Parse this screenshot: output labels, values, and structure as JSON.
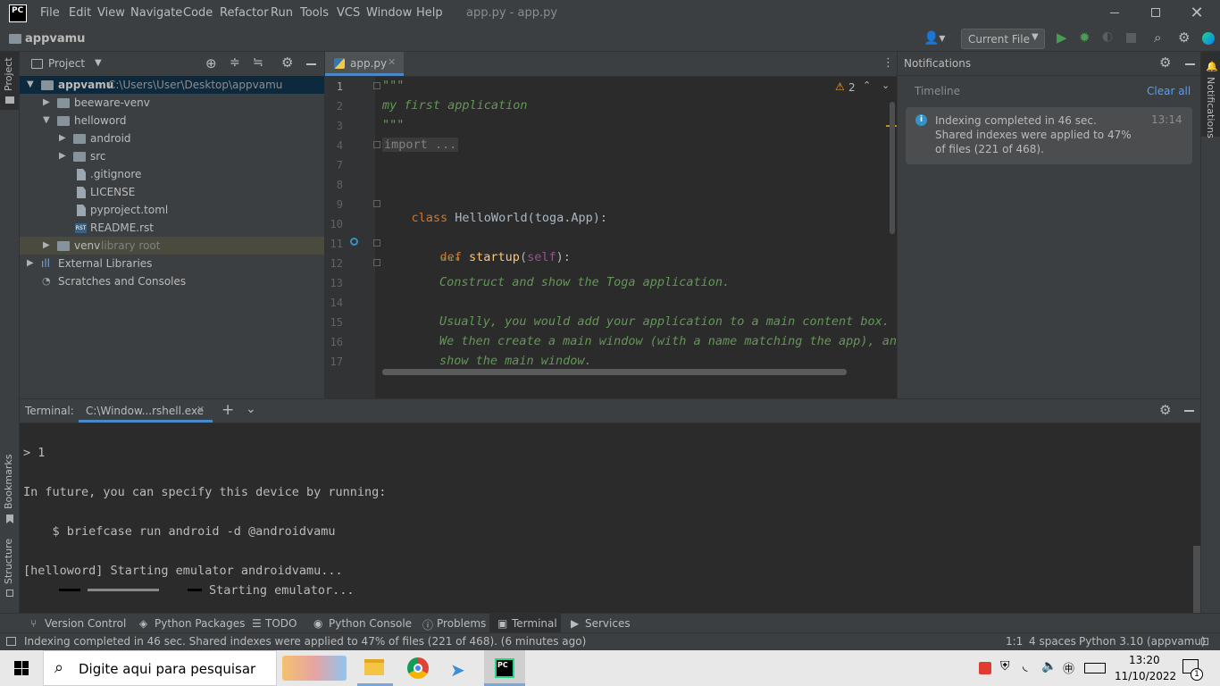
{
  "window": {
    "title": "app.py - app.py",
    "menu": [
      "File",
      "Edit",
      "View",
      "Navigate",
      "Code",
      "Refactor",
      "Run",
      "Tools",
      "VCS",
      "Window",
      "Help"
    ]
  },
  "navbar": {
    "project_name": "appvamu",
    "run_config": "Current File"
  },
  "left_stripe": {
    "project_tab": "Project",
    "bookmarks_tab": "Bookmarks",
    "structure_tab": "Structure"
  },
  "right_stripe": {
    "notifications_tab": "Notifications"
  },
  "project_panel": {
    "title": "Project",
    "tree": [
      {
        "label": "appvamu",
        "path": "C:\\Users\\User\\Desktop\\appvamu"
      },
      {
        "label": "beeware-venv"
      },
      {
        "label": "helloword"
      },
      {
        "label": "android"
      },
      {
        "label": "src"
      },
      {
        "label": ".gitignore"
      },
      {
        "label": "LICENSE"
      },
      {
        "label": "pyproject.toml"
      },
      {
        "label": "README.rst"
      },
      {
        "label": "venv",
        "suffix": "library root"
      },
      {
        "label": "External Libraries"
      },
      {
        "label": "Scratches and Consoles"
      }
    ]
  },
  "editor": {
    "tab": "app.py",
    "warning_count": "2",
    "line_numbers": [
      "1",
      "2",
      "3",
      "4",
      "7",
      "8",
      "9",
      "10",
      "11",
      "12",
      "13",
      "14",
      "15",
      "16",
      "17"
    ],
    "lines": {
      "l1": "\"\"\"",
      "l2": "my first application",
      "l3": "\"\"\"",
      "l4": "import ...",
      "l9_kw": "class ",
      "l9_name": "HelloWorld",
      "l9_rest": "(toga.App):",
      "l11_kw": "def ",
      "l11_name": "startup",
      "l11_p1": "(",
      "l11_self": "self",
      "l11_p2": "):",
      "l12": "\"\"\"",
      "l13": "Construct and show the Toga application.",
      "l15": "Usually, you would add your application to a main content box.",
      "l16": "We then create a main window (with a name matching the app), and",
      "l17": "show the main window."
    }
  },
  "notifications": {
    "title": "Notifications",
    "timeline": "Timeline",
    "clear_all": "Clear all",
    "message": "Indexing completed in 46 sec. Shared indexes were applied to 47% of files (221 of 468).",
    "time": "13:14"
  },
  "terminal": {
    "label": "Terminal:",
    "tab": "C:\\Window...rshell.exe",
    "lines": {
      "t1": "> 1",
      "t2": "In future, you can specify this device by running:",
      "t3": "    $ briefcase run android -d @androidvamu",
      "t4": "[helloword] Starting emulator androidvamu...",
      "t5": "Starting emulator..."
    }
  },
  "toolwindows": [
    "Version Control",
    "Python Packages",
    "TODO",
    "Python Console",
    "Problems",
    "Terminal",
    "Services"
  ],
  "status": {
    "message": "Indexing completed in 46 sec. Shared indexes were applied to 47% of files (221 of 468). (6 minutes ago)",
    "position": "1:1",
    "indent": "4 spaces",
    "interpreter": "Python 3.10 (appvamu)"
  },
  "taskbar": {
    "search_placeholder": "Digite aqui para pesquisar",
    "time": "13:20",
    "date": "11/10/2022",
    "notification_count": "1"
  },
  "colors": {
    "accent": "#4a88c7",
    "keyword": "#cc7832",
    "docstring": "#629755",
    "function": "#ffc66d",
    "self": "#94558d",
    "run_green": "#499c54"
  }
}
